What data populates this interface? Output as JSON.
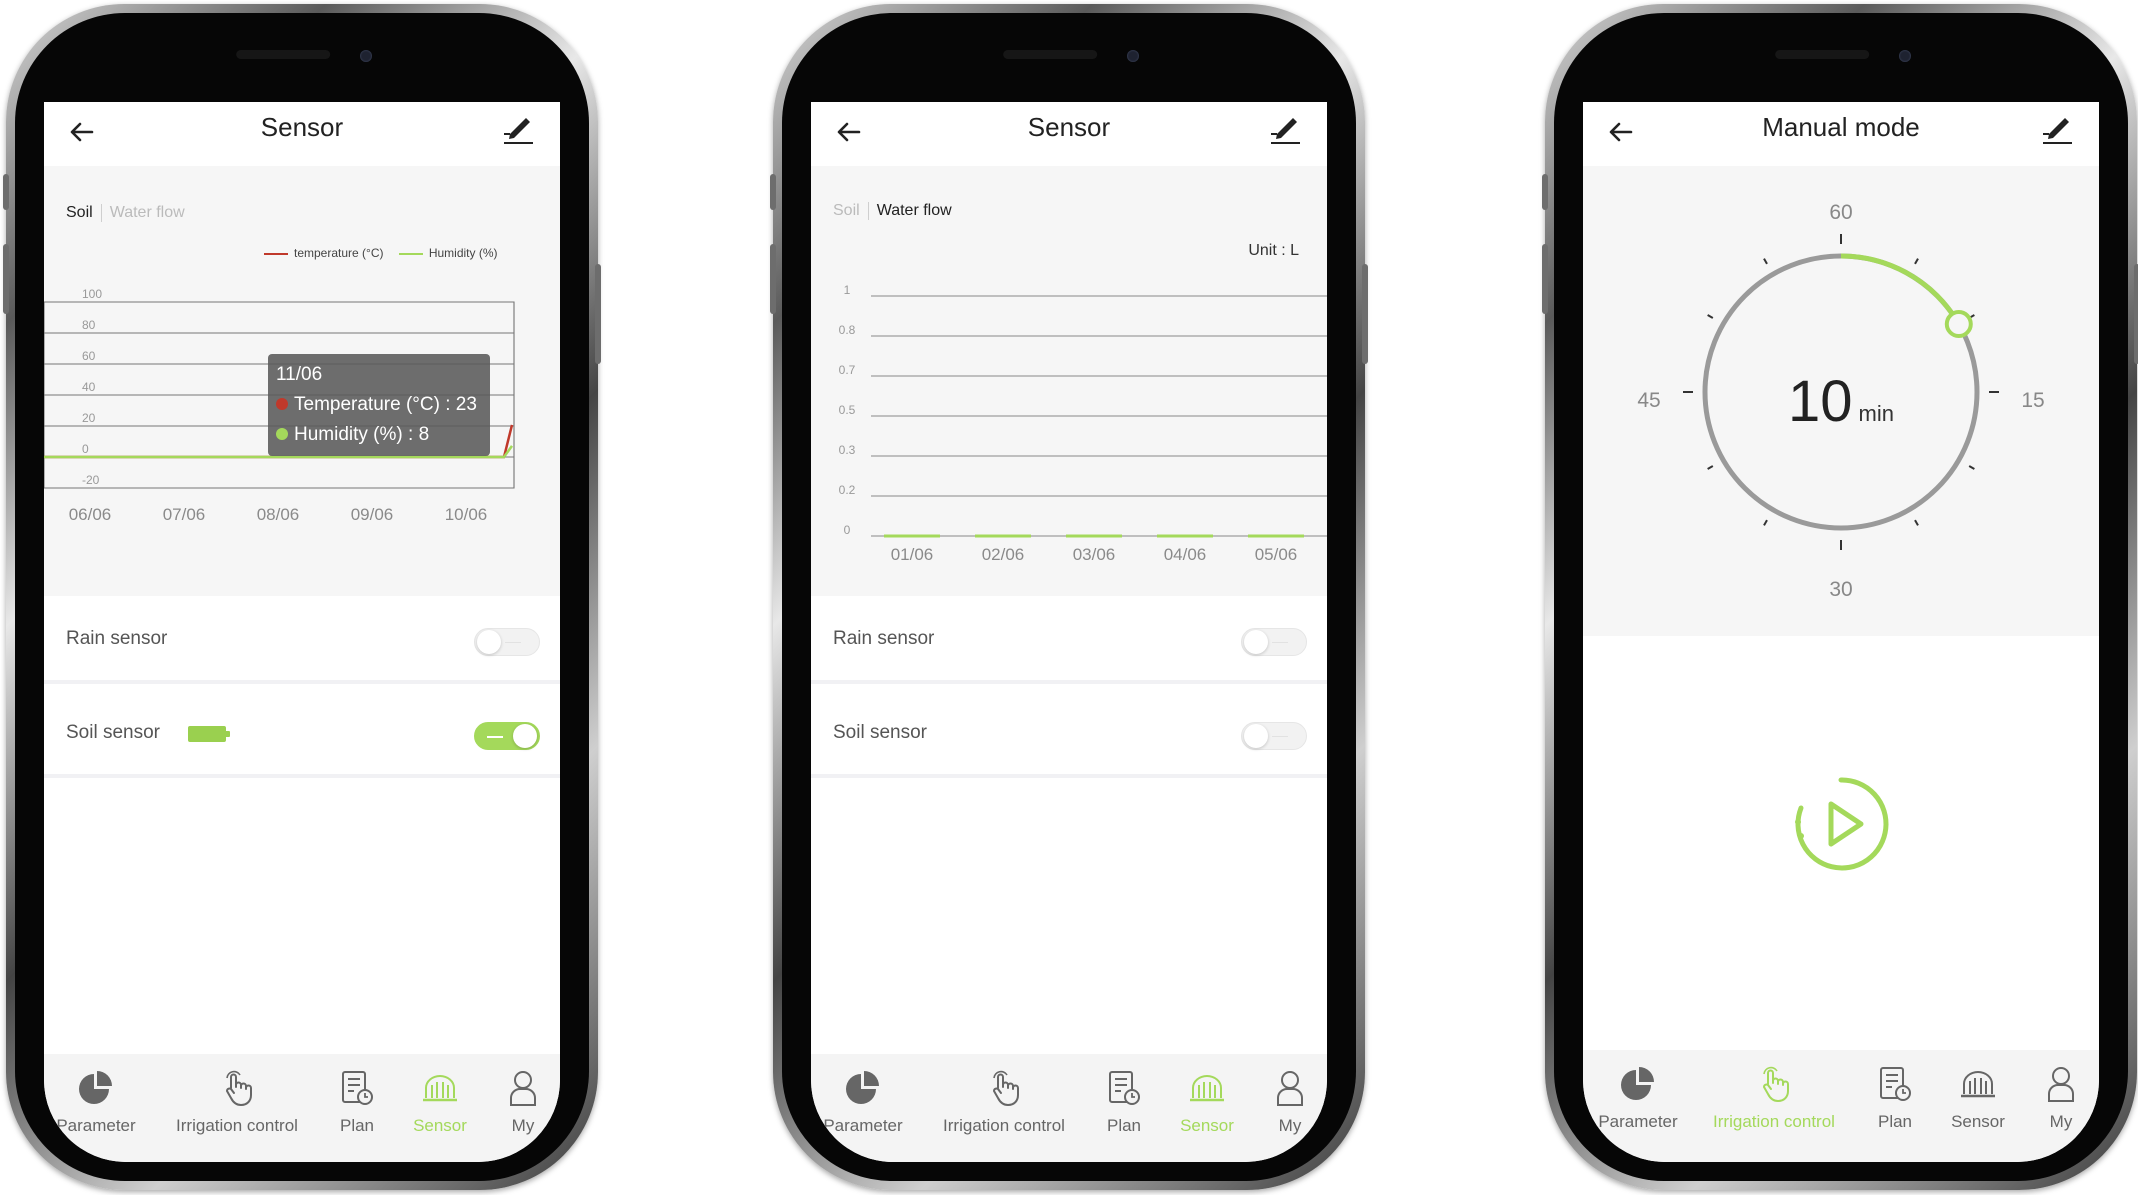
{
  "colors": {
    "accent": "#a4d95b",
    "temperature": "#c0392b",
    "humidity": "#a4d95b",
    "toggle_off": "#f2f2f2"
  },
  "nav": {
    "items": [
      {
        "label": "Parameter",
        "icon": "pie-chart-icon"
      },
      {
        "label": "Irrigation control",
        "icon": "hand-touch-icon"
      },
      {
        "label": "Plan",
        "icon": "plan-clock-icon"
      },
      {
        "label": "Sensor",
        "icon": "sensor-dome-icon"
      },
      {
        "label": "My",
        "icon": "user-icon"
      }
    ]
  },
  "phone1": {
    "title": "Sensor",
    "seg": {
      "soil": "Soil",
      "water": "Water flow",
      "active": "soil"
    },
    "legend": {
      "temperature": "temperature (°C)",
      "humidity": "Humidity (%)"
    },
    "tooltip": {
      "date": "11/06",
      "temperature": "Temperature (°C) : 23",
      "humidity": "Humidity (%) : 8"
    },
    "rows": [
      {
        "label": "Rain sensor",
        "on": false
      },
      {
        "label": "Soil sensor",
        "on": true,
        "battery": "full"
      }
    ],
    "active_nav": "Sensor"
  },
  "phone2": {
    "title": "Sensor",
    "seg": {
      "soil": "Soil",
      "water": "Water flow",
      "active": "water"
    },
    "unit": "Unit : L",
    "rows": [
      {
        "label": "Rain sensor",
        "on": false
      },
      {
        "label": "Soil sensor",
        "on": false
      }
    ],
    "active_nav": "Sensor"
  },
  "phone3": {
    "title": "Manual mode",
    "dial": {
      "value": "10",
      "unit": "min",
      "labels": {
        "top": "60",
        "right": "15",
        "bottom": "30",
        "left": "45"
      },
      "fraction": 0.1667
    },
    "play": "play-icon",
    "active_nav": "Irrigation control"
  },
  "chart_data": [
    {
      "type": "line",
      "title": "",
      "xlabel": "",
      "ylabel": "",
      "categories": [
        "06/06",
        "07/06",
        "08/06",
        "09/06",
        "10/06"
      ],
      "y_ticks": [
        "100",
        "80",
        "60",
        "40",
        "20",
        "0",
        "-20"
      ],
      "ylim": [
        -20,
        100
      ],
      "series": [
        {
          "name": "temperature (°C)",
          "values": [
            0,
            0,
            0,
            0,
            0,
            23
          ]
        },
        {
          "name": "Humidity (%)",
          "values": [
            0,
            0,
            0,
            0,
            0,
            8
          ]
        }
      ],
      "x_points": [
        "06/06",
        "07/06",
        "08/06",
        "09/06",
        "10/06",
        "11/06"
      ],
      "legend_position": "top-right",
      "grid": true
    },
    {
      "type": "line",
      "title": "",
      "unit": "Unit : L",
      "categories": [
        "01/06",
        "02/06",
        "03/06",
        "04/06",
        "05/06"
      ],
      "y_ticks": [
        "1",
        "0.8",
        "0.7",
        "0.5",
        "0.3",
        "0.2",
        "0"
      ],
      "series": [
        {
          "values": [
            0,
            0,
            0,
            0,
            0
          ]
        }
      ],
      "grid": true
    }
  ]
}
